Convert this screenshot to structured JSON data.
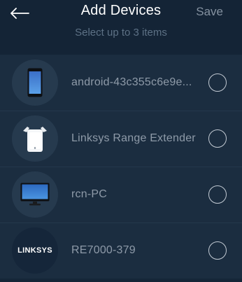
{
  "header": {
    "back_icon": "arrow-left-icon",
    "title": "Add Devices",
    "save_label": "Save",
    "subtitle": "Select up to 3 items"
  },
  "devices": [
    {
      "label": "android-43c355c6e9e...",
      "icon": "android-phone-icon",
      "selected": false
    },
    {
      "label": "Linksys Range Extender",
      "icon": "range-extender-icon",
      "selected": false
    },
    {
      "label": "rcn-PC",
      "icon": "desktop-monitor-icon",
      "selected": false
    },
    {
      "label": "RE7000-379",
      "icon": "linksys-logo",
      "logo_text": "LINKSYS",
      "selected": false
    }
  ]
}
